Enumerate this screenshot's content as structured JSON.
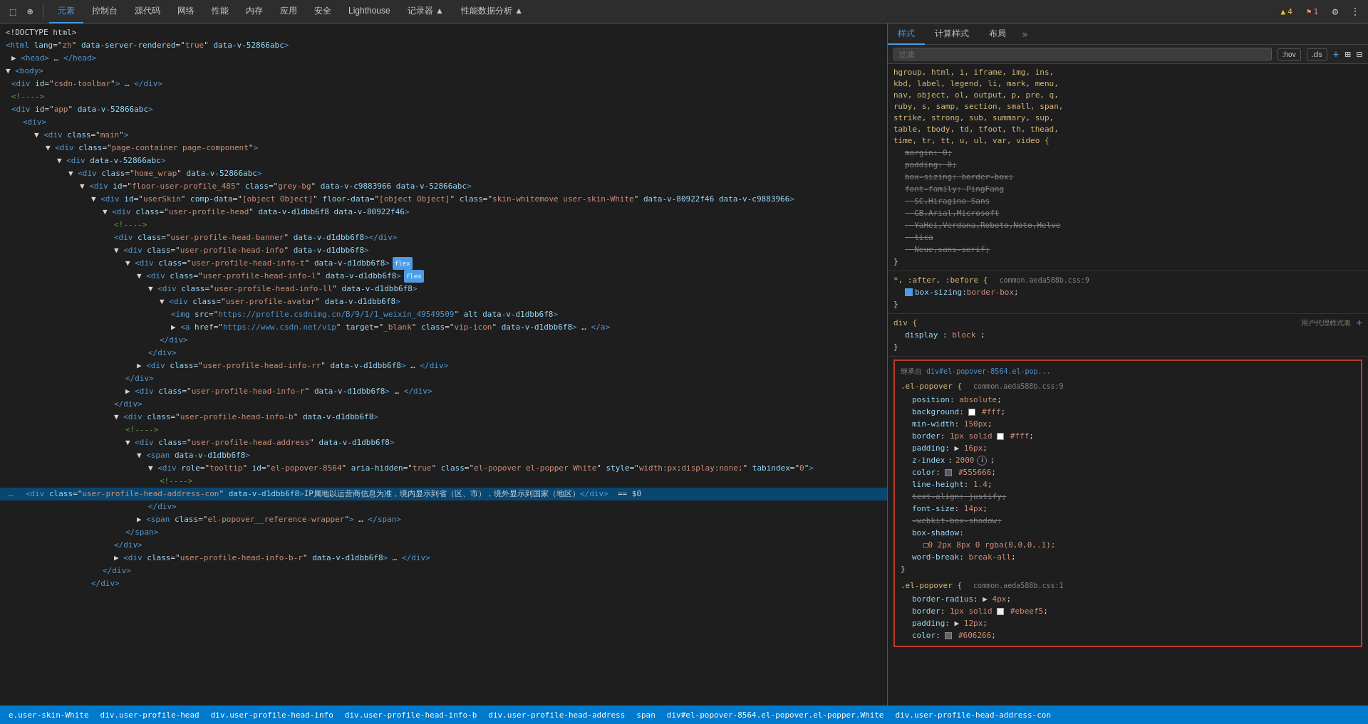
{
  "toolbar": {
    "icons": [
      "cursor-icon",
      "inspect-icon"
    ],
    "tabs": [
      {
        "label": "元素",
        "active": true
      },
      {
        "label": "控制台",
        "active": false
      },
      {
        "label": "源代码",
        "active": false
      },
      {
        "label": "网络",
        "active": false
      },
      {
        "label": "性能",
        "active": false
      },
      {
        "label": "内存",
        "active": false
      },
      {
        "label": "应用",
        "active": false
      },
      {
        "label": "安全",
        "active": false
      },
      {
        "label": "Lighthouse",
        "active": false
      },
      {
        "label": "记录器 ▲",
        "active": false
      },
      {
        "label": "性能数据分析 ▲",
        "active": false
      }
    ],
    "warnings": "4",
    "errors": "1"
  },
  "html_lines": [
    {
      "indent": 0,
      "content": "<!DOCTYPE html>"
    },
    {
      "indent": 0,
      "content": "<html lang=\"zh\" data-server-rendered=\"true\" data-v-52866abc>"
    },
    {
      "indent": 1,
      "content": "▶ <head> … </head>"
    },
    {
      "indent": 0,
      "content": "▼ <body>"
    },
    {
      "indent": 1,
      "content": "<div id=\"csdn-toolbar\"> … </div>"
    },
    {
      "indent": 1,
      "content": "<!---->"
    },
    {
      "indent": 1,
      "content": "<div id=\"app\" data-v-52866abc>"
    },
    {
      "indent": 2,
      "content": "<div>"
    },
    {
      "indent": 3,
      "content": "▼ <div class=\"main\">"
    },
    {
      "indent": 4,
      "content": "▼ <div class=\"page-container page-component\">"
    },
    {
      "indent": 5,
      "content": "▼ <div data-v-52866abc>"
    },
    {
      "indent": 6,
      "content": "▼ <div class=\"home_wrap\" data-v-52866abc>"
    },
    {
      "indent": 7,
      "content": "▼ <div id=\"floor-user-profile_485\" class=\"grey-bg\" data-v-c9883966 data-v-52866abc>"
    },
    {
      "indent": 8,
      "content": "▼ <div id=\"userSkin\" comp-data=\"[object Object]\" floor-data=\"[object Object]\" class=\"skin-whitemove user-skin-White\" data-v-80922f46 data-v-c9883966>"
    },
    {
      "indent": 9,
      "content": "▼ <div class=\"user-profile-head\" data-v-d1dbb6f8 data-v-80922f46>"
    },
    {
      "indent": 10,
      "content": "<!---->"
    },
    {
      "indent": 10,
      "content": "<div class=\"user-profile-head-banner\" data-v-d1dbb6f8></div>"
    },
    {
      "indent": 10,
      "content": "▼ <div class=\"user-profile-head-info\" data-v-d1dbb6f8>"
    },
    {
      "indent": 11,
      "content": "▼ <div class=\"user-profile-head-info-t\" data-v-d1dbb6f8> flex"
    },
    {
      "indent": 12,
      "content": "▼ <div class=\"user-profile-head-info-l\" data-v-d1dbb6f8> flex"
    },
    {
      "indent": 13,
      "content": "▼ <div class=\"user-profile-head-info-ll\" data-v-d1dbb6f8>"
    },
    {
      "indent": 14,
      "content": "▼ <div class=\"user-profile-avatar\" data-v-d1dbb6f8>"
    },
    {
      "indent": 15,
      "content": "<img src=\"https://profile.csdnimg.cn/B/9/1/1_weixin_49549509\" alt data-v-d1dbb6f8>"
    },
    {
      "indent": 15,
      "content": "▶ <a href=\"https://www.csdn.net/vip\" target=\"_blank\" class=\"vip-icon\" data-v-d1dbb6f8> … </a>"
    },
    {
      "indent": 14,
      "content": "</div>"
    },
    {
      "indent": 13,
      "content": "</div>"
    },
    {
      "indent": 12,
      "content": "▶ <div class=\"user-profile-head-info-rr\" data-v-d1dbb6f8> … </div>"
    },
    {
      "indent": 11,
      "content": "</div>"
    },
    {
      "indent": 11,
      "content": "▶ <div class=\"user-profile-head-info-r\" data-v-d1dbb6f8> … </div>"
    },
    {
      "indent": 10,
      "content": "</div>"
    },
    {
      "indent": 10,
      "content": "▼ <div class=\"user-profile-head-info-b\" data-v-d1dbb6f8>"
    },
    {
      "indent": 11,
      "content": "<!---->"
    },
    {
      "indent": 11,
      "content": "▼ <div class=\"user-profile-head-address\" data-v-d1dbb6f8>"
    },
    {
      "indent": 12,
      "content": "▼ <span data-v-d1dbb6f8>"
    },
    {
      "indent": 13,
      "content": "▼ <div role=\"tooltip\" id=\"el-popover-8564\" aria-hidden=\"true\" class=\"el-popover el-popper White\" style=\"width:px;display:none;\" tabindex=\"0\">"
    },
    {
      "indent": 14,
      "content": "<!---->"
    },
    {
      "indent": 14,
      "content": "...  <div class=\"user-profile-head-address-con\" data-v-d1dbb6f8>IP属地以运营商信息为准，境内显示到省（区、市），境外显示到国家（地区）</div>  == $0",
      "selected": true
    },
    {
      "indent": 13,
      "content": "</div>"
    },
    {
      "indent": 12,
      "content": "▶ <span class=\"el-popover__reference-wrapper\"> … </span>"
    },
    {
      "indent": 11,
      "content": "</span>"
    },
    {
      "indent": 10,
      "content": "</div>"
    },
    {
      "indent": 10,
      "content": "▶ <div class=\"user-profile-head-info-b-r\" data-v-d1dbb6f8> … </div>"
    },
    {
      "indent": 9,
      "content": "</div>"
    },
    {
      "indent": 8,
      "content": "</div>"
    }
  ],
  "styles_panel": {
    "tabs": [
      "样式",
      "计算样式",
      "布局",
      ">>"
    ],
    "filter_placeholder": "过滤",
    "filter_buttons": [
      ":hov",
      ".cls"
    ],
    "global_selector": {
      "selector": "hgroup, html, i, iframe, img, ins, kbd, label, legend, li, mark, menu, nav, object, ol, output, p, pre, q, ruby, s, samp, section, small, span, strike, strong, sub, summary, sup, table, tbody, td, tfoot, th, thead, time, tr, tt, u, ul, var, video {",
      "props": [
        {
          "name": "margin",
          "value": "0",
          "strikethrough": false,
          "checked": false
        },
        {
          "name": "padding",
          "value": "0",
          "strikethrough": false,
          "checked": false
        },
        {
          "name": "box-sizing",
          "value": "border-box",
          "strikethrough": false,
          "checked": false
        },
        {
          "name": "font-family",
          "value": "PingFang SC,Hiragino Sans GB,Arial,Microsoft YaHei,Verdana,Roboto,Noto,Helvetica Neue,sans-serif",
          "strikethrough": false,
          "checked": false
        }
      ],
      "source": ""
    },
    "after_before": {
      "selector": "*, :after, :before {",
      "source": "common.aeda588b.css:9",
      "props": [
        {
          "name": "box-sizing",
          "value": "border-box",
          "strikethrough": false,
          "checked": true
        }
      ]
    },
    "div_rule": {
      "selector": "div {",
      "comment": "用户代理样式表",
      "props": [
        {
          "name": "display",
          "value": "block",
          "strikethrough": false
        }
      ]
    },
    "inherited_section": {
      "from": "继承自 div#el-popover-8564.el-pop...",
      "selector": ".el-popover {",
      "source": "common.aeda588b.css:9",
      "props": [
        {
          "name": "position",
          "value": "absolute",
          "strikethrough": false
        },
        {
          "name": "background",
          "value": "#fff",
          "strikethrough": false,
          "color": "#fff"
        },
        {
          "name": "min-width",
          "value": "150px",
          "strikethrough": false
        },
        {
          "name": "border",
          "value": "1px solid #fff",
          "strikethrough": false,
          "color": "#fff"
        },
        {
          "name": "padding",
          "value": "16px",
          "strikethrough": false
        },
        {
          "name": "z-index",
          "value": "2000",
          "strikethrough": false,
          "hasInfo": true
        },
        {
          "name": "color",
          "value": "#555666",
          "strikethrough": false,
          "color": "#555666"
        },
        {
          "name": "line-height",
          "value": "1.4",
          "strikethrough": false
        },
        {
          "name": "text-align",
          "value": "justify",
          "strikethrough": true
        },
        {
          "name": "font-size",
          "value": "14px",
          "strikethrough": false
        },
        {
          "name": "-webkit-box-shadow",
          "value": "",
          "strikethrough": true
        },
        {
          "name": "box-shadow",
          "value": "0 2px 8px 0 rgba(0,0,0,.1)",
          "strikethrough": false
        },
        {
          "name": "word-break",
          "value": "break-all",
          "strikethrough": false
        }
      ]
    },
    "el_popover2": {
      "selector": ".el-popover {",
      "source": "common.aeda588b.css:1",
      "props": [
        {
          "name": "border-radius",
          "value": "4px",
          "strikethrough": false
        },
        {
          "name": "border",
          "value": "1px solid #ebeef5",
          "strikethrough": false,
          "color": "#ebeef5"
        },
        {
          "name": "padding",
          "value": "12px",
          "strikethrough": false
        },
        {
          "name": "color",
          "value": "#606266",
          "strikethrough": false,
          "color": "#606266"
        }
      ]
    }
  },
  "breadcrumb": {
    "items": [
      "e.user-skin-White",
      "div.user-profile-head",
      "div.user-profile-head-info",
      "div.user-profile-head-info-b",
      "div.user-profile-head-address",
      "span",
      "div#el-popover-8564.el-popover.el-popper.White",
      "div.user-profile-head-address-con"
    ]
  }
}
